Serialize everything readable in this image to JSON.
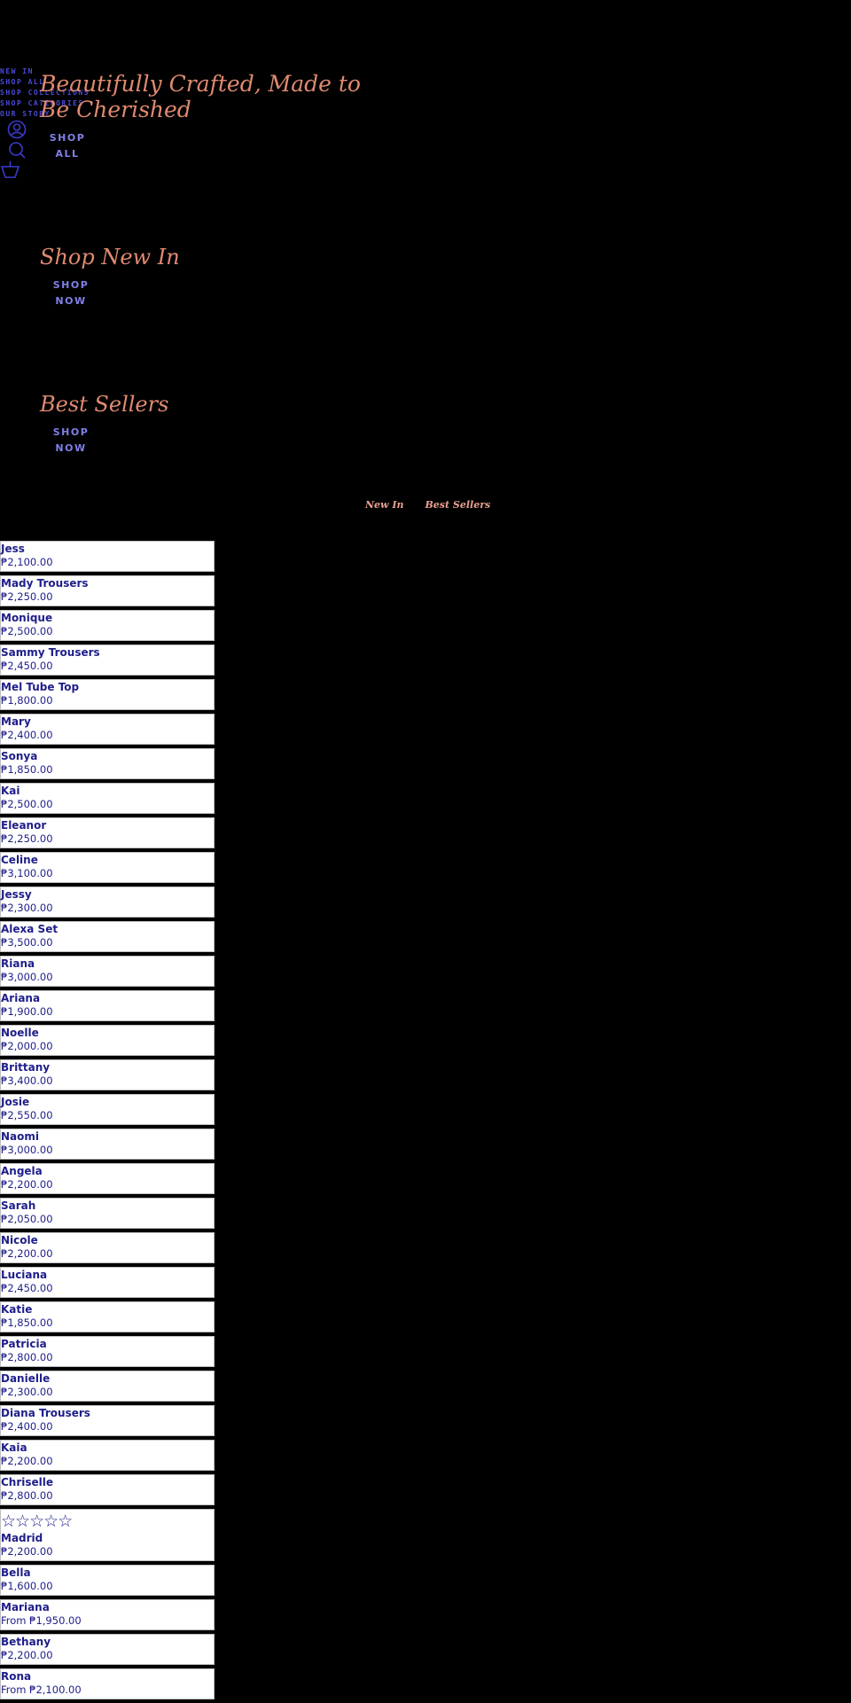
{
  "nav": {
    "items": [
      {
        "label": "NEW IN"
      },
      {
        "label": "SHOP ALL"
      },
      {
        "label": "SHOP COLLECTIONS"
      },
      {
        "label": "SHOP CATEGORIES"
      },
      {
        "label": "OUR STORY"
      }
    ],
    "icons": [
      "account-icon",
      "search-icon",
      "cart-icon"
    ]
  },
  "hero": {
    "title": "Beautifully Crafted, Made to Be Cherished",
    "cta": "SHOP ALL"
  },
  "sections": [
    {
      "title": "Shop New In",
      "cta": "SHOP NOW"
    },
    {
      "title": "Best Sellers",
      "cta": "SHOP NOW"
    }
  ],
  "tabs": [
    "New In",
    "Best Sellers"
  ],
  "colors": {
    "background": "#000000",
    "heading": "#e08a70",
    "nav": "#4a4ad8",
    "product_text": "#1e1e8a"
  },
  "products": [
    {
      "name": "Jess",
      "price": "₱2,100.00"
    },
    {
      "name": "Mady Trousers",
      "price": "₱2,250.00"
    },
    {
      "name": "Monique",
      "price": "₱2,500.00"
    },
    {
      "name": "Sammy Trousers",
      "price": "₱2,450.00"
    },
    {
      "name": "Mel Tube Top",
      "price": "₱1,800.00"
    },
    {
      "name": "Mary",
      "price": "₱2,400.00"
    },
    {
      "name": "Sonya",
      "price": "₱1,850.00"
    },
    {
      "name": "Kai",
      "price": "₱2,500.00"
    },
    {
      "name": "Eleanor",
      "price": "₱2,250.00"
    },
    {
      "name": "Celine",
      "price": "₱3,100.00"
    },
    {
      "name": "Jessy",
      "price": "₱2,300.00"
    },
    {
      "name": "Alexa Set",
      "price": "₱3,500.00"
    },
    {
      "name": "Riana",
      "price": "₱3,000.00"
    },
    {
      "name": "Ariana",
      "price": "₱1,900.00"
    },
    {
      "name": "Noelle",
      "price": "₱2,000.00"
    },
    {
      "name": "Brittany",
      "price": "₱3,400.00"
    },
    {
      "name": "Josie",
      "price": "₱2,550.00"
    },
    {
      "name": "Naomi",
      "price": "₱3,000.00"
    },
    {
      "name": "Angela",
      "price": "₱2,200.00"
    },
    {
      "name": "Sarah",
      "price": "₱2,050.00"
    },
    {
      "name": "Nicole",
      "price": "₱2,200.00"
    },
    {
      "name": "Luciana",
      "price": "₱2,450.00"
    },
    {
      "name": "Katie",
      "price": "₱1,850.00"
    },
    {
      "name": "Patricia",
      "price": "₱2,800.00"
    },
    {
      "name": "Danielle",
      "price": "₱2,300.00"
    },
    {
      "name": "Diana Trousers",
      "price": "₱2,400.00"
    },
    {
      "name": "Kaia",
      "price": "₱2,200.00"
    },
    {
      "name": "Chriselle",
      "price": "₱2,800.00"
    },
    {
      "name": "Madrid",
      "price": "₱2,200.00",
      "rating": 0,
      "rating_max": 5,
      "stars": "☆☆☆☆☆"
    },
    {
      "name": "Bella",
      "price": "₱1,600.00"
    },
    {
      "name": "Mariana",
      "price": "From ₱1,950.00"
    },
    {
      "name": "Bethany",
      "price": "₱2,200.00"
    },
    {
      "name": "Rona",
      "price": "From ₱2,100.00"
    }
  ]
}
